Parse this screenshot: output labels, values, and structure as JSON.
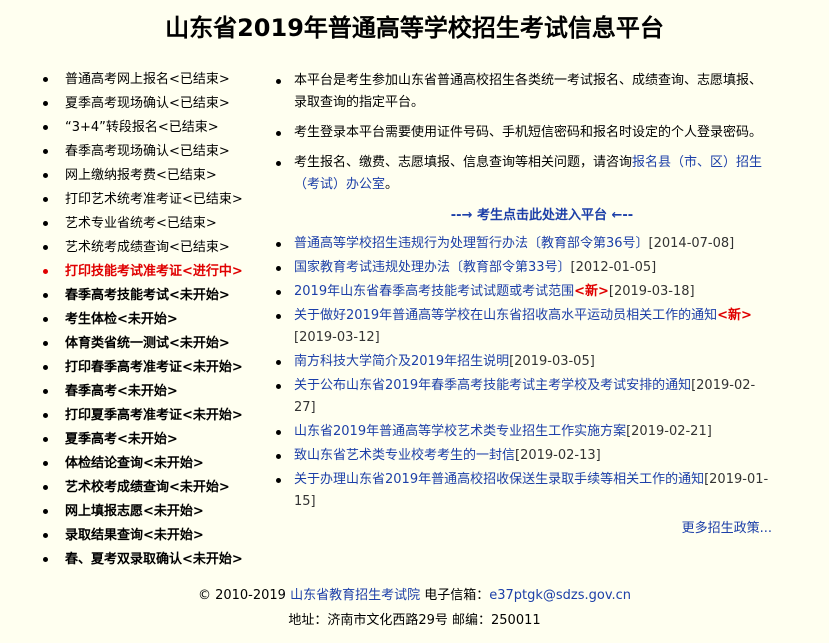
{
  "page": {
    "title": "山东省2019年普通高等学校招生考试信息平台"
  },
  "menu": [
    {
      "label": "普通高考网上报名<已结束>",
      "state": "done"
    },
    {
      "label": "夏季高考现场确认<已结束>",
      "state": "done"
    },
    {
      "label": "“3+4”转段报名<已结束>",
      "state": "done"
    },
    {
      "label": "春季高考现场确认<已结束>",
      "state": "done"
    },
    {
      "label": "网上缴纳报考费<已结束>",
      "state": "done"
    },
    {
      "label": "打印艺术统考准考证<已结束>",
      "state": "done"
    },
    {
      "label": "艺术专业省统考<已结束>",
      "state": "done"
    },
    {
      "label": "艺术统考成绩查询<已结束>",
      "state": "done"
    },
    {
      "label": "打印技能考试准考证<进行中>",
      "state": "active"
    },
    {
      "label": "春季高考技能考试<未开始>",
      "state": "todo"
    },
    {
      "label": "考生体检<未开始>",
      "state": "todo"
    },
    {
      "label": "体育类省统一测试<未开始>",
      "state": "todo"
    },
    {
      "label": "打印春季高考准考证<未开始>",
      "state": "todo"
    },
    {
      "label": "春季高考<未开始>",
      "state": "todo"
    },
    {
      "label": "打印夏季高考准考证<未开始>",
      "state": "todo"
    },
    {
      "label": "夏季高考<未开始>",
      "state": "todo"
    },
    {
      "label": "体检结论查询<未开始>",
      "state": "todo"
    },
    {
      "label": "艺术校考成绩查询<未开始>",
      "state": "todo"
    },
    {
      "label": "网上填报志愿<未开始>",
      "state": "todo"
    },
    {
      "label": "录取结果查询<未开始>",
      "state": "todo"
    },
    {
      "label": "春、夏考双录取确认<未开始>",
      "state": "todo"
    }
  ],
  "notices": {
    "n1": "本平台是考生参加山东省普通高校招生各类统一考试报名、成绩查询、志愿填报、录取查询的指定平台。",
    "n2": "考生登录本平台需要使用证件号码、手机短信密码和报名时设定的个人登录密码。",
    "n3_text": "考生报名、缴费、志愿填报、信息查询等相关问题，请咨询",
    "n3_link": "报名县（市、区）招生（考试）办公室",
    "n3_end": "。"
  },
  "enter_link": "--→ 考生点击此处进入平台 ←--",
  "news": [
    {
      "title": "普通高等学校招生违规行为处理暂行办法〔教育部令第36号〕",
      "new": "",
      "date": "[2014-07-08]"
    },
    {
      "title": "国家教育考试违规处理办法〔教育部令第33号〕",
      "new": "",
      "date": "[2012-01-05]"
    },
    {
      "title": "2019年山东省春季高考技能考试试题或考试范围",
      "new": "<新>",
      "date": "[2019-03-18]"
    },
    {
      "title": "关于做好2019年普通高等学校在山东省招收高水平运动员相关工作的通知",
      "new": "<新>",
      "date": "[2019-03-12]"
    },
    {
      "title": "南方科技大学简介及2019年招生说明",
      "new": "",
      "date": "[2019-03-05]"
    },
    {
      "title": "关于公布山东省2019年春季高考技能考试主考学校及考试安排的通知",
      "new": "",
      "date": "[2019-02-27]"
    },
    {
      "title": "山东省2019年普通高等学校艺术类专业招生工作实施方案",
      "new": "",
      "date": "[2019-02-21]"
    },
    {
      "title": "致山东省艺术类专业校考考生的一封信",
      "new": "",
      "date": "[2019-02-13]"
    },
    {
      "title": "关于办理山东省2019年普通高校招收保送生录取手续等相关工作的通知",
      "new": "",
      "date": "[2019-01-15]"
    }
  ],
  "more_link": "更多招生政策...",
  "footer": {
    "copyright": "© 2010-2019 ",
    "org_link": "山东省教育招生考试院",
    "email_label": " 电子信箱：",
    "email": "e37ptgk@sdzs.gov.cn",
    "address": "地址：济南市文化西路29号 邮编：250011"
  },
  "colors": {
    "background": "#fffff0",
    "link": "#1c3fa8",
    "active": "#e00000"
  }
}
